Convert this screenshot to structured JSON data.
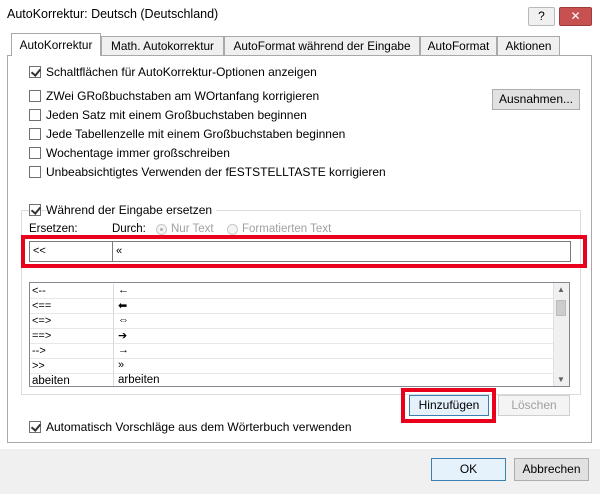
{
  "window": {
    "title": "AutoKorrektur: Deutsch (Deutschland)",
    "help_label": "?",
    "close_label": "✕"
  },
  "tabs": [
    {
      "label": "AutoKorrektur"
    },
    {
      "label": "Math. Autokorrektur"
    },
    {
      "label": "AutoFormat während der Eingabe"
    },
    {
      "label": "AutoFormat"
    },
    {
      "label": "Aktionen"
    }
  ],
  "options": {
    "show_buttons": "Schaltflächen für AutoKorrektur-Optionen anzeigen",
    "two_caps": "ZWei GRoßbuchstaben am WOrtanfang korrigieren",
    "sentence_caps": "Jeden Satz mit einem Großbuchstaben beginnen",
    "table_caps": "Jede Tabellenzelle mit einem Großbuchstaben beginnen",
    "weekdays": "Wochentage immer großschreiben",
    "capslock": "Unbeabsichtigtes Verwenden der fESTSTELLTASTE korrigieren",
    "exceptions_button": "Ausnahmen..."
  },
  "replace": {
    "while_typing": "Während der Eingabe ersetzen",
    "replace_label": "Ersetzen:",
    "with_label": "Durch:",
    "plain_text": "Nur Text",
    "formatted_text": "Formatierten Text",
    "replace_value": "<<",
    "with_value": "«"
  },
  "list": [
    {
      "from": "<--",
      "to": "←"
    },
    {
      "from": "<==",
      "to": "⬅"
    },
    {
      "from": "<=>",
      "to": "⇔"
    },
    {
      "from": "==>",
      "to": "➔"
    },
    {
      "from": "-->",
      "to": "→"
    },
    {
      "from": ">>",
      "to": "»"
    },
    {
      "from": "abeiten",
      "to": "arbeiten"
    }
  ],
  "actions": {
    "add_button": "Hinzufügen",
    "delete_button": "Löschen"
  },
  "dictionary_suggestions": "Automatisch Vorschläge aus dem Wörterbuch verwenden",
  "footer": {
    "ok_button": "OK",
    "cancel_button": "Abbrechen"
  }
}
